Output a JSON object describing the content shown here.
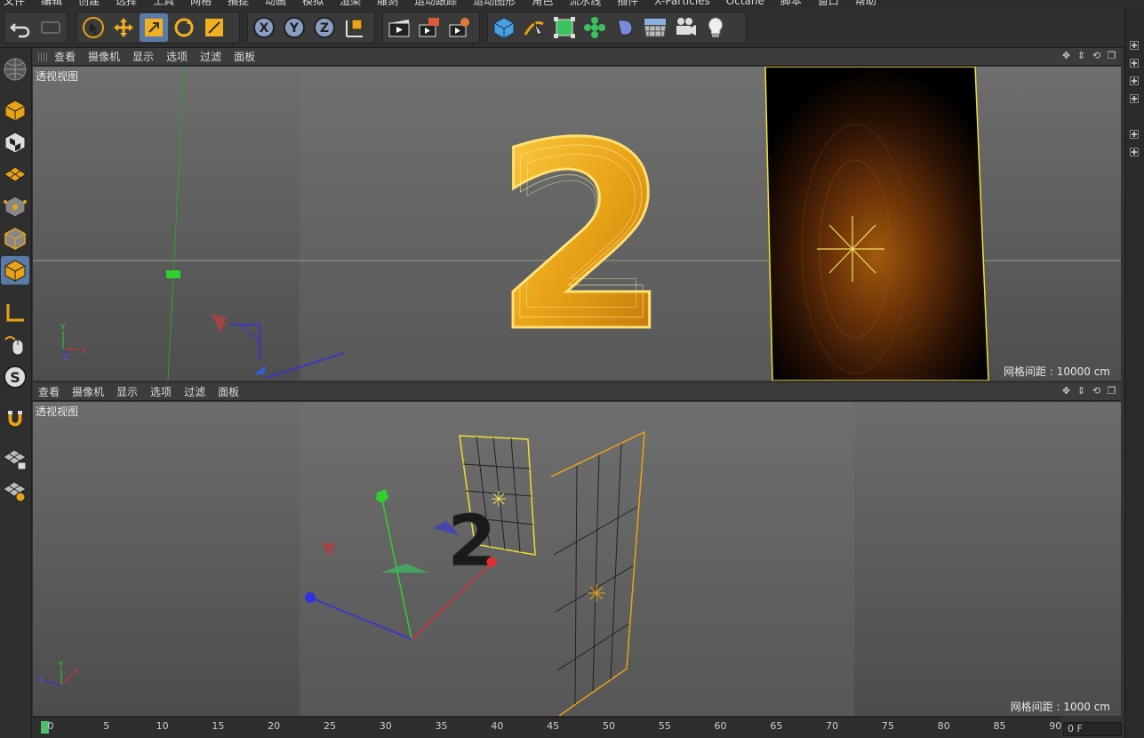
{
  "menu": [
    "文件",
    "编辑",
    "创建",
    "选择",
    "工具",
    "网格",
    "捕捉",
    "动画",
    "模拟",
    "渲染",
    "雕刻",
    "运动跟踪",
    "运动图形",
    "角色",
    "流水线",
    "插件",
    "X-Particles",
    "Octane",
    "脚本",
    "窗口",
    "帮助"
  ],
  "viewport_menu": [
    "查看",
    "摄像机",
    "显示",
    "选项",
    "过滤",
    "面板"
  ],
  "viewports": [
    {
      "label": "透视视图",
      "grid": "网格间距 : 10000 cm"
    },
    {
      "label": "透视视图",
      "grid": "网格间距 : 1000 cm"
    }
  ],
  "axis_labels": {
    "x": "X",
    "y": "Y",
    "z": "Z"
  },
  "object_text": "2",
  "timeline": {
    "ticks": [
      "0",
      "5",
      "10",
      "15",
      "20",
      "25",
      "30",
      "35",
      "40",
      "45",
      "50",
      "55",
      "60",
      "65",
      "70",
      "75",
      "80",
      "85",
      "90"
    ],
    "current_frame": "0 F"
  },
  "icons": {
    "toolbar": [
      "undo-icon",
      "redo-icon",
      "select-icon",
      "move-icon",
      "scale-icon",
      "rotate-icon",
      "recent-tool-icon",
      "x-axis-icon",
      "y-axis-icon",
      "z-axis-icon",
      "coordinate-icon",
      "render-view-icon",
      "render-picture-icon",
      "render-settings-icon",
      "cube-icon",
      "pen-icon",
      "subdivision-icon",
      "cloner-icon",
      "deformer-icon",
      "floor-icon",
      "camera-icon",
      "light-icon"
    ]
  },
  "colors": {
    "accent": "#5a7aa8",
    "gold": "#e8a317",
    "green": "#2fd02f",
    "red": "#e03030",
    "blue": "#3030e0"
  }
}
